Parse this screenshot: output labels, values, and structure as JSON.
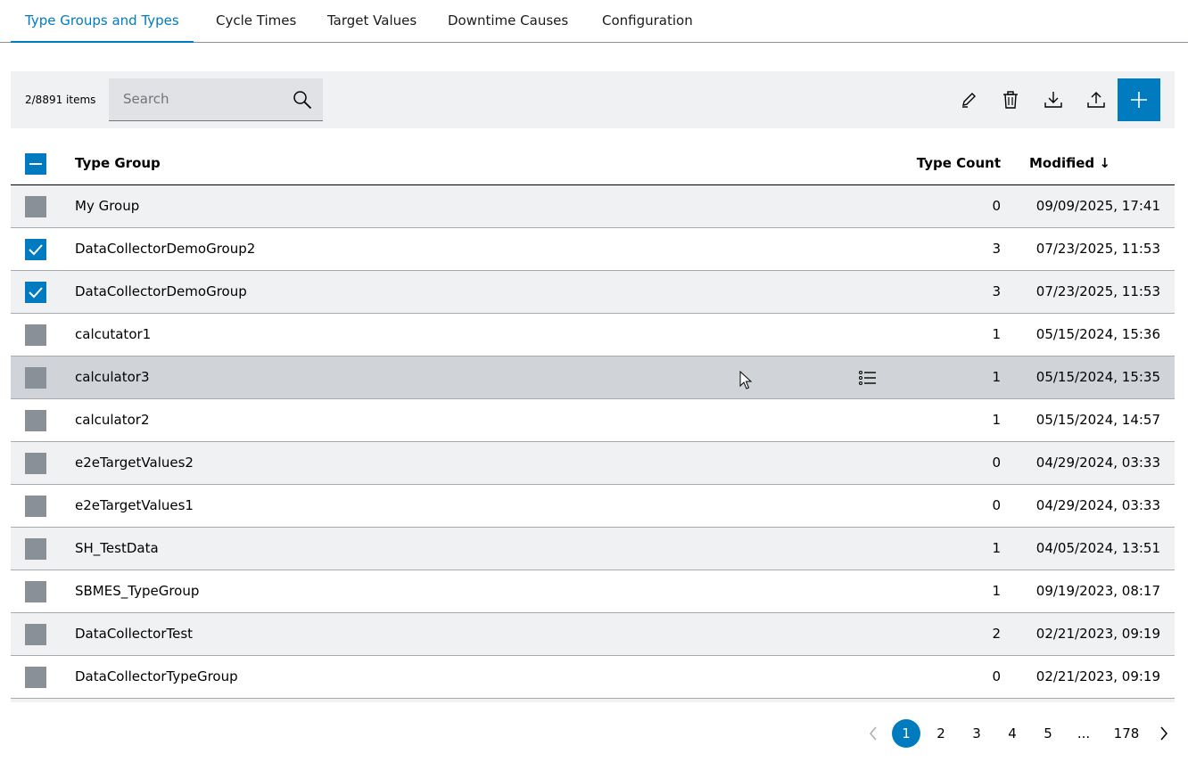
{
  "tabs": [
    {
      "label": "Type Groups and Types",
      "active": true
    },
    {
      "label": "Cycle Times",
      "active": false
    },
    {
      "label": "Target Values",
      "active": false
    },
    {
      "label": "Downtime Causes",
      "active": false
    },
    {
      "label": "Configuration",
      "active": false
    }
  ],
  "toolbar": {
    "item_count": "2/8891 items",
    "search_placeholder": "Search",
    "search_value": "",
    "icons": [
      "edit-icon",
      "delete-icon",
      "download-icon",
      "upload-icon",
      "add-icon"
    ]
  },
  "table": {
    "columns": {
      "name": "Type Group",
      "count": "Type Count",
      "modified": "Modified ↓"
    },
    "header_checkbox": "indeterminate",
    "rows": [
      {
        "name": "My Group",
        "count": "0",
        "modified": "09/09/2025, 17:41",
        "checked": false
      },
      {
        "name": "DataCollectorDemoGroup2",
        "count": "3",
        "modified": "07/23/2025, 11:53",
        "checked": true
      },
      {
        "name": "DataCollectorDemoGroup",
        "count": "3",
        "modified": "07/23/2025, 11:53",
        "checked": true
      },
      {
        "name": "calcutator1",
        "count": "1",
        "modified": "05/15/2024, 15:36",
        "checked": false
      },
      {
        "name": "calculator3",
        "count": "1",
        "modified": "05/15/2024, 15:35",
        "checked": false,
        "hovered": true
      },
      {
        "name": "calculator2",
        "count": "1",
        "modified": "05/15/2024, 14:57",
        "checked": false
      },
      {
        "name": "e2eTargetValues2",
        "count": "0",
        "modified": "04/29/2024, 03:33",
        "checked": false
      },
      {
        "name": "e2eTargetValues1",
        "count": "0",
        "modified": "04/29/2024, 03:33",
        "checked": false
      },
      {
        "name": "SH_TestData",
        "count": "1",
        "modified": "04/05/2024, 13:51",
        "checked": false
      },
      {
        "name": "SBMES_TypeGroup",
        "count": "1",
        "modified": "09/19/2023, 08:17",
        "checked": false
      },
      {
        "name": "DataCollectorTest",
        "count": "2",
        "modified": "02/21/2023, 09:19",
        "checked": false
      },
      {
        "name": "DataCollectorTypeGroup",
        "count": "0",
        "modified": "02/21/2023, 09:19",
        "checked": false
      }
    ]
  },
  "pagination": {
    "pages": [
      "1",
      "2",
      "3",
      "4",
      "5",
      "...",
      "178"
    ],
    "current": "1"
  },
  "colors": {
    "accent": "#007bc0",
    "checkbox_unchecked": "#8a9097",
    "row_alt": "#eff1f2",
    "row_hover": "#d0d4d8"
  }
}
